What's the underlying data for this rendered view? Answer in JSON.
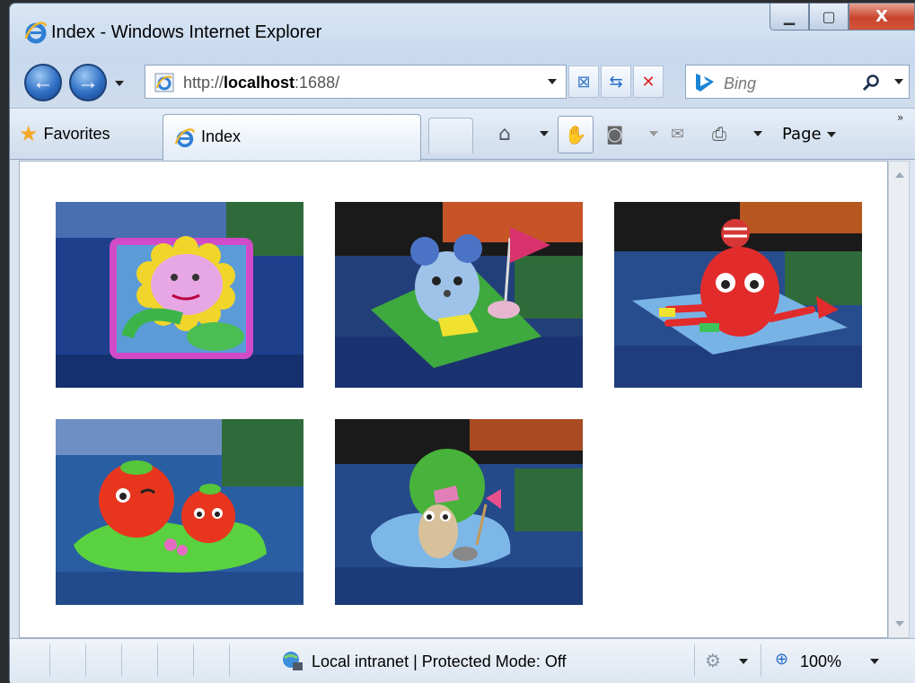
{
  "window": {
    "title": "Index - Windows Internet Explorer",
    "controls": {
      "minimize": "▁",
      "maximize": "▢",
      "close": "X"
    }
  },
  "navbar": {
    "back_icon": "back-arrow-icon",
    "forward_icon": "forward-arrow-icon",
    "address_prefix": "http://",
    "address_host": "localhost",
    "address_suffix": ":1688/",
    "search_placeholder": "Bing"
  },
  "favorites_bar": {
    "favorites_label": "Favorites",
    "tab_label": "Index",
    "page_menu_label": "Page"
  },
  "content": {
    "images": [
      {
        "name": "clay-sunflower-photo"
      },
      {
        "name": "clay-mouse-photo"
      },
      {
        "name": "clay-octopus-photo"
      },
      {
        "name": "clay-strawberries-photo"
      },
      {
        "name": "clay-snail-photo"
      }
    ]
  },
  "statusbar": {
    "zone_text": "Local intranet | Protected Mode: Off",
    "zoom_text": "100%"
  },
  "colors": {
    "close_button": "#c7442b",
    "nav_button": "#2f6fc4",
    "calendar_blue": "#1d3f8c"
  }
}
